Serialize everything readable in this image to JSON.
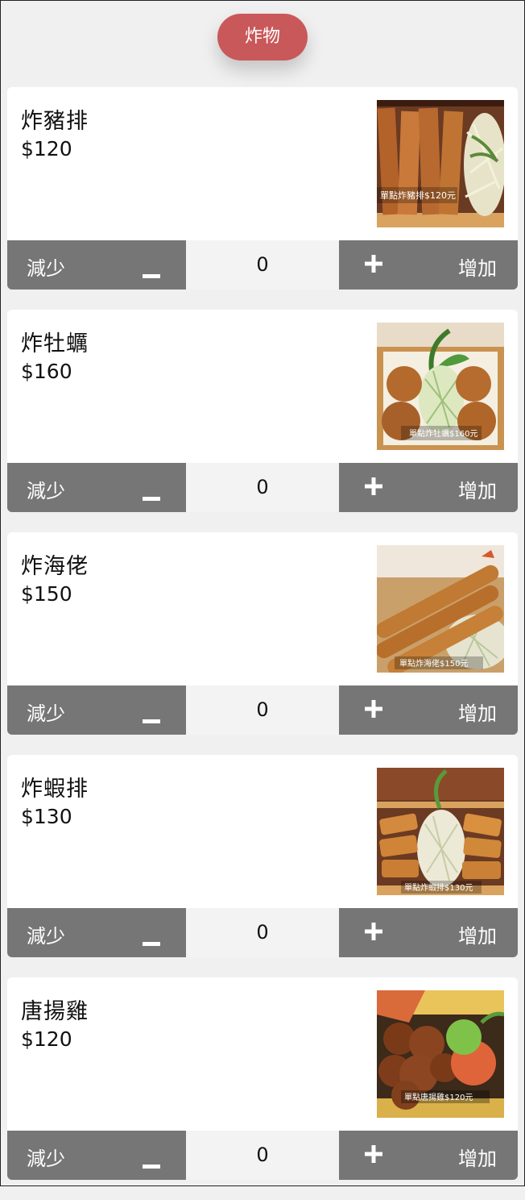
{
  "category": {
    "label": "炸物",
    "color": "#c9585a"
  },
  "controls": {
    "decrease_label": "減少",
    "increase_label": "增加"
  },
  "items": [
    {
      "name": "炸豬排",
      "price": "$120",
      "quantity": "0",
      "photo_caption": "單點炸豬排$120元",
      "photo_kind": "pork-cutlet"
    },
    {
      "name": "炸牡蠣",
      "price": "$160",
      "quantity": "0",
      "photo_caption": "單點炸牡蠣$160元",
      "photo_kind": "fried-oysters"
    },
    {
      "name": "炸海佬",
      "price": "$150",
      "quantity": "0",
      "photo_caption": "單點炸海佬$150元",
      "photo_kind": "fried-shrimp"
    },
    {
      "name": "炸蝦排",
      "price": "$130",
      "quantity": "0",
      "photo_caption": "單點炸蝦排$130元",
      "photo_kind": "shrimp-cutlet"
    },
    {
      "name": "唐揚雞",
      "price": "$120",
      "quantity": "0",
      "photo_caption": "單點唐揚雞$120元",
      "photo_kind": "karaage-chicken"
    }
  ]
}
